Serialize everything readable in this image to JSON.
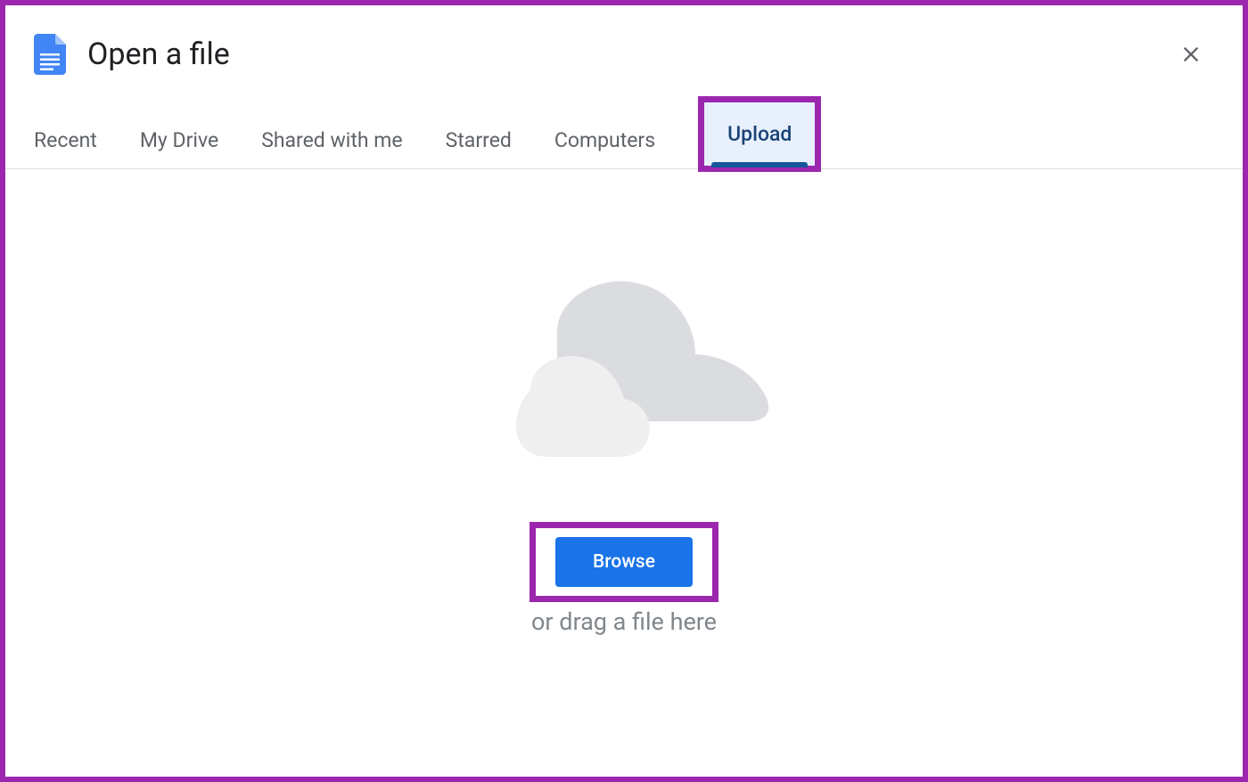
{
  "dialog": {
    "title": "Open a file"
  },
  "tabs": {
    "items": [
      {
        "label": "Recent"
      },
      {
        "label": "My Drive"
      },
      {
        "label": "Shared with me"
      },
      {
        "label": "Starred"
      },
      {
        "label": "Computers"
      },
      {
        "label": "Upload"
      }
    ]
  },
  "upload": {
    "browse_label": "Browse",
    "drag_hint": "or drag a file here"
  }
}
